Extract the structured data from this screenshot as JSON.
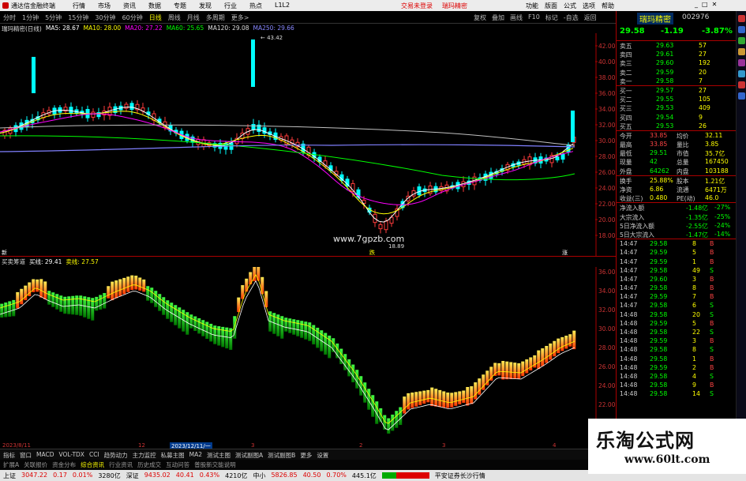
{
  "titlebar": {
    "app_title": "通达信金融终端",
    "menu": [
      "行情",
      "市场",
      "资讯",
      "数据",
      "专题",
      "发现",
      "行业",
      "热点",
      "L1L2"
    ],
    "promo1": "交易未登录",
    "promo2": "瑞玛精密",
    "right": [
      "功能",
      "版面",
      "公式",
      "选项",
      "帮助"
    ]
  },
  "periodbar": {
    "tabs": [
      "分时",
      "1分钟",
      "5分钟",
      "15分钟",
      "30分钟",
      "60分钟",
      "日线",
      "周线",
      "月线",
      "多周期",
      "更多>"
    ],
    "active": "日线",
    "tools": [
      "复权",
      "叠加",
      "画线",
      "F10",
      "标记",
      "-自选",
      "返回"
    ]
  },
  "kline_legend": {
    "title": "瑞玛精密(日线)",
    "ma5": "MA5: 28.67",
    "ma10": "MA10: 28.00",
    "ma20": "MA20: 27.22",
    "ma60": "MA60: 25.65",
    "ma120": "MA120: 29.08",
    "ma250": "MA250: 29.66"
  },
  "kline": {
    "y_ticks": [
      "42.00",
      "40.00",
      "38.00",
      "36.00",
      "34.00",
      "32.00",
      "30.00",
      "28.00",
      "26.00",
      "24.00",
      "22.00",
      "20.00",
      "18.00"
    ],
    "peak_label": "43.42",
    "low_label": "18.89",
    "markers": [
      "新",
      "跌",
      "涨"
    ]
  },
  "indicator_legend": {
    "title": "买卖筹道",
    "buy": "买线: 29.41",
    "sell": "卖线: 27.57"
  },
  "indicator": {
    "y_ticks": [
      "36.00",
      "34.00",
      "32.00",
      "30.00",
      "28.00",
      "26.00",
      "24.00",
      "22.00",
      "20.00"
    ]
  },
  "xaxis": {
    "labels": [
      "2023/8/11",
      "12",
      "2023/12/11/一",
      "3",
      "2",
      "3",
      "4"
    ]
  },
  "watermark": "www.7gpzb.com",
  "bottom_tabs": [
    "指标",
    "窗口",
    "MACD",
    "VOL-TDX",
    "CCI",
    "趋势动力",
    "主力监控",
    "私募主图",
    "MA2",
    "测试主图",
    "测试副图A",
    "测试副图B",
    "更多",
    "设置"
  ],
  "bottom_tabs2": [
    "扩展A",
    "关联报价",
    "资金分布",
    "综合资讯",
    "行业资讯",
    "历史成交",
    "互动问答",
    "普股新交能说明"
  ],
  "bottom_tabs2_active": "综合资讯",
  "statusbar": {
    "sh": "上证",
    "sh_val": "3047.22",
    "sh_chg": "0.17",
    "sh_pct": "0.01%",
    "sh_amt": "3280亿",
    "sz": "深证",
    "sz_val": "9435.02",
    "sz_chg": "40.41",
    "sz_pct": "0.43%",
    "sz_amt": "4210亿",
    "zx": "中小",
    "zx_val": "5826.85",
    "zx_chg": "40.50",
    "zx_pct": "0.70%",
    "zx_amt": "445.1亿",
    "broker": "平安证券长沙行情"
  },
  "right_panel": {
    "time": "14:48:35",
    "stock_name": "瑞玛精密",
    "stock_code": "002976",
    "price": "29.58",
    "change": "-1.19",
    "pct": "-3.87%",
    "asks": [
      {
        "label": "卖五",
        "price": "29.63",
        "vol": "57"
      },
      {
        "label": "卖四",
        "price": "29.61",
        "vol": "27"
      },
      {
        "label": "卖三",
        "price": "29.60",
        "vol": "192"
      },
      {
        "label": "卖二",
        "price": "29.59",
        "vol": "20"
      },
      {
        "label": "卖一",
        "price": "29.58",
        "vol": "7"
      }
    ],
    "bids": [
      {
        "label": "买一",
        "price": "29.57",
        "vol": "27"
      },
      {
        "label": "买二",
        "price": "29.55",
        "vol": "105"
      },
      {
        "label": "买三",
        "price": "29.53",
        "vol": "409"
      },
      {
        "label": "买四",
        "price": "29.54",
        "vol": "9"
      },
      {
        "label": "买五",
        "price": "29.53",
        "vol": "26"
      }
    ],
    "quote": [
      {
        "l1": "今开",
        "v1": "33.85",
        "l2": "均价",
        "v2": "32.11"
      },
      {
        "l1": "最高",
        "v1": "33.85",
        "l2": "量比",
        "v2": "3.85"
      },
      {
        "l1": "最低",
        "v1": "29.51",
        "l2": "市值",
        "v2": "35.7亿"
      },
      {
        "l1": "现量",
        "v1": "42",
        "l2": "总量",
        "v2": "167450"
      },
      {
        "l1": "外盘",
        "v1": "64262",
        "l2": "内盘",
        "v2": "103188"
      }
    ],
    "stats": [
      {
        "l1": "换手",
        "v1": "25.88%",
        "l2": "股本",
        "v2": "1.21亿"
      },
      {
        "l1": "净资",
        "v1": "6.86",
        "l2": "流通",
        "v2": "6471万"
      },
      {
        "l1": "收益(三)",
        "v1": "0.480",
        "l2": "PE(动)",
        "v2": "46.0"
      }
    ],
    "flows": [
      {
        "label": "净流入额",
        "val": "-1.48亿",
        "pct": "-27%"
      },
      {
        "label": "大宗流入",
        "val": "-1.35亿",
        "pct": "-25%"
      },
      {
        "label": "5日净流入额",
        "val": "-2.55亿",
        "pct": "-24%"
      },
      {
        "label": "5日大宗流入",
        "val": "-1.47亿",
        "pct": "-14%"
      }
    ],
    "ticks": [
      {
        "t": "14:47",
        "p": "29.58",
        "v": "8",
        "d": "B"
      },
      {
        "t": "14:47",
        "p": "29.59",
        "v": "5",
        "d": "B"
      },
      {
        "t": "14:47",
        "p": "29.59",
        "v": "1",
        "d": "B"
      },
      {
        "t": "14:47",
        "p": "29.58",
        "v": "49",
        "d": "S"
      },
      {
        "t": "14:47",
        "p": "29.60",
        "v": "3",
        "d": "B"
      },
      {
        "t": "14:47",
        "p": "29.58",
        "v": "8",
        "d": "B"
      },
      {
        "t": "14:47",
        "p": "29.59",
        "v": "7",
        "d": "B"
      },
      {
        "t": "14:47",
        "p": "29.58",
        "v": "6",
        "d": "S"
      },
      {
        "t": "14:48",
        "p": "29.58",
        "v": "20",
        "d": "S"
      },
      {
        "t": "14:48",
        "p": "29.59",
        "v": "5",
        "d": "B"
      },
      {
        "t": "14:48",
        "p": "29.58",
        "v": "22",
        "d": "S"
      },
      {
        "t": "14:48",
        "p": "29.59",
        "v": "3",
        "d": "B"
      },
      {
        "t": "14:48",
        "p": "29.58",
        "v": "8",
        "d": "S"
      },
      {
        "t": "14:48",
        "p": "29.58",
        "v": "1",
        "d": "B"
      },
      {
        "t": "14:48",
        "p": "29.59",
        "v": "2",
        "d": "B"
      },
      {
        "t": "14:48",
        "p": "29.58",
        "v": "4",
        "d": "S"
      },
      {
        "t": "14:48",
        "p": "29.58",
        "v": "9",
        "d": "B"
      },
      {
        "t": "14:48",
        "p": "29.58",
        "v": "14",
        "d": "S"
      }
    ]
  },
  "brand": {
    "line1": "乐淘公式网",
    "line2": "www.60lt.com"
  },
  "colors": {
    "up": "#ff3b3b",
    "down": "#00ffff",
    "ma5": "#ffffff",
    "ma10": "#ffff00",
    "ma20": "#ff00ff",
    "ma60": "#00ff00",
    "ma120": "#8080ff",
    "ma250": "#c0c0c0"
  }
}
